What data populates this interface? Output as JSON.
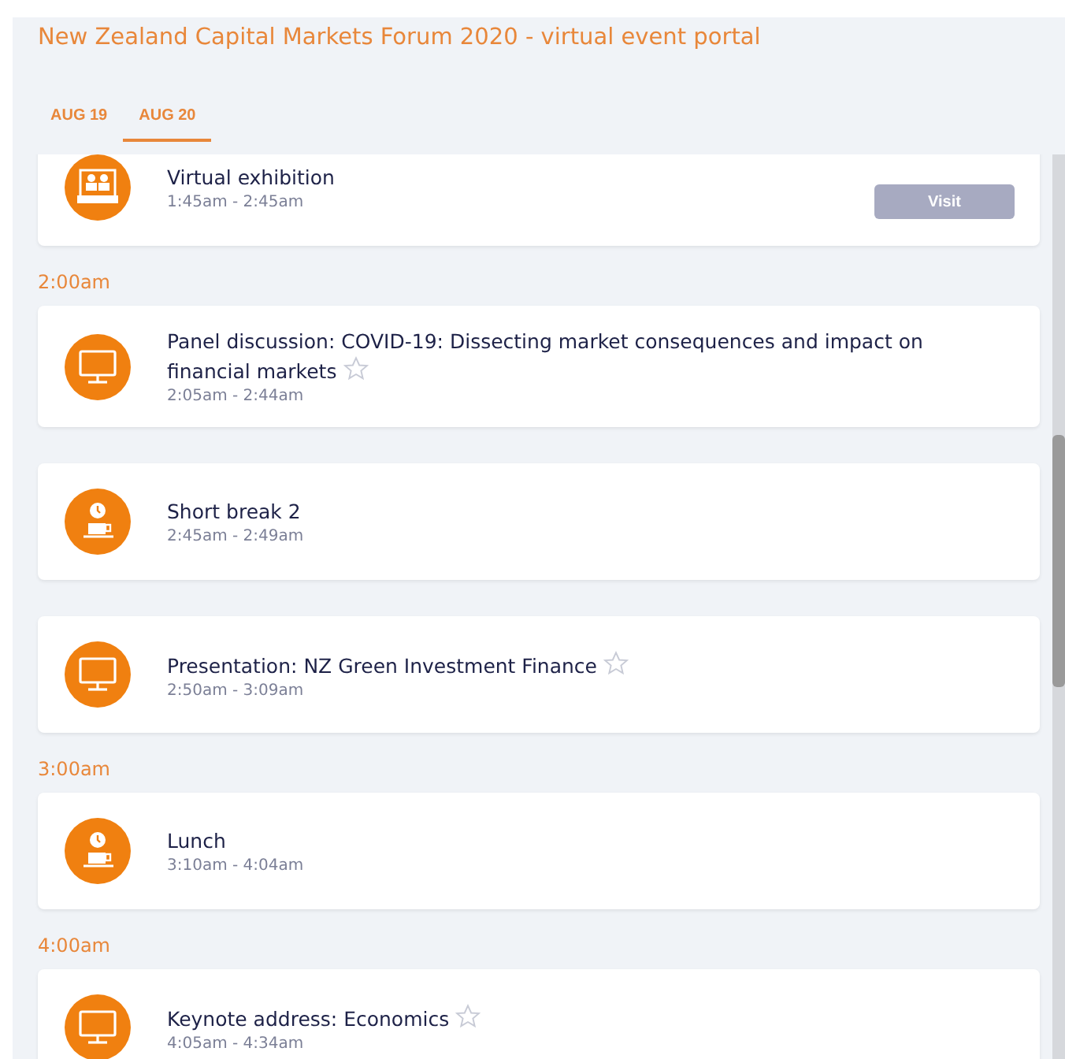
{
  "title": "New Zealand Capital Markets Forum 2020 - virtual event portal",
  "tabs": [
    {
      "label": "AUG 19",
      "selected": false
    },
    {
      "label": "AUG 20",
      "selected": true
    }
  ],
  "schedule": [
    {
      "kind": "exhibit",
      "title": "Virtual exhibition",
      "time": "1:45am - 2:45am",
      "star": false,
      "button": "Visit"
    },
    {
      "kind": "hour",
      "label": "2:00am"
    },
    {
      "kind": "talk",
      "title": "Panel discussion: COVID-19: Dissecting market consequences and impact on financial markets",
      "time": "2:05am - 2:44am",
      "star": true
    },
    {
      "kind": "break",
      "title": "Short break 2",
      "time": "2:45am - 2:49am",
      "star": false
    },
    {
      "kind": "talk",
      "title": "Presentation: NZ Green Investment Finance",
      "time": "2:50am - 3:09am",
      "star": true
    },
    {
      "kind": "hour",
      "label": "3:00am"
    },
    {
      "kind": "break",
      "title": "Lunch",
      "time": "3:10am - 4:04am",
      "star": false
    },
    {
      "kind": "hour",
      "label": "4:00am"
    },
    {
      "kind": "talk",
      "title": "Keynote address: Economics",
      "time": "4:05am - 4:34am",
      "star": true
    }
  ]
}
